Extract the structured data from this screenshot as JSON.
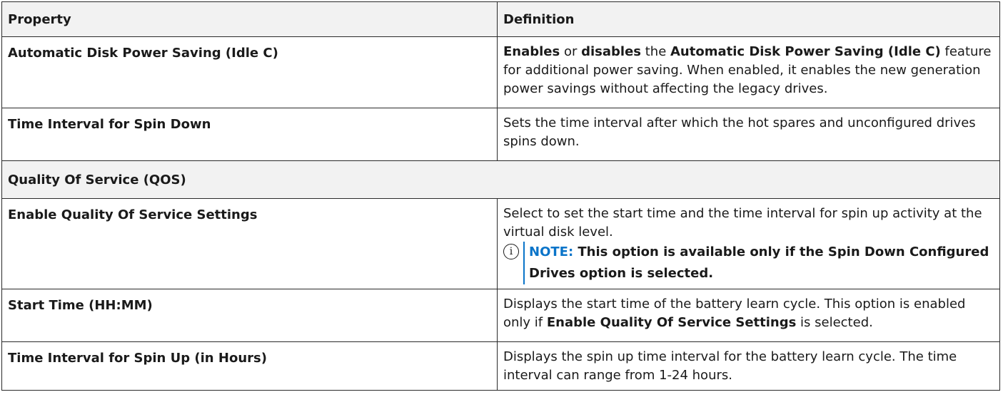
{
  "headers": {
    "property": "Property",
    "definition": "Definition"
  },
  "rows": [
    {
      "property": "Automatic Disk Power Saving (Idle C)",
      "definition": {
        "b1": "Enables",
        "t1": " or ",
        "b2": "disables",
        "t2": " the ",
        "b3": "Automatic Disk Power Saving (Idle C)",
        "t3": " feature for additional power saving. When enabled, it enables the new generation power savings without affecting the legacy drives."
      }
    },
    {
      "property": "Time Interval for Spin Down",
      "definition": "Sets the time interval after which the hot spares and unconfigured drives spins down."
    },
    {
      "section": "Quality Of Service (QOS)"
    },
    {
      "property": "Enable Quality Of Service Settings",
      "definition": "Select to set the start time and the time interval for spin up activity at the virtual disk level.",
      "note": {
        "icon": "info-icon",
        "glyph": "i",
        "label": "NOTE:",
        "text": " This option is available only if the Spin Down Configured Drives option is selected."
      }
    },
    {
      "property": "Start Time (HH:MM)",
      "definition": {
        "t1": "Displays the start time of the battery learn cycle. This option is enabled only if ",
        "b1": "Enable Quality Of Service Settings",
        "t2": " is selected."
      }
    },
    {
      "property": "Time Interval for Spin Up (in Hours)",
      "definition": "Displays the spin up time interval for the battery learn cycle. The time interval can range from 1-24 hours."
    }
  ],
  "colors": {
    "note_accent": "#0a74c9",
    "header_bg": "#f2f2f2",
    "border": "#2a2a2a"
  }
}
